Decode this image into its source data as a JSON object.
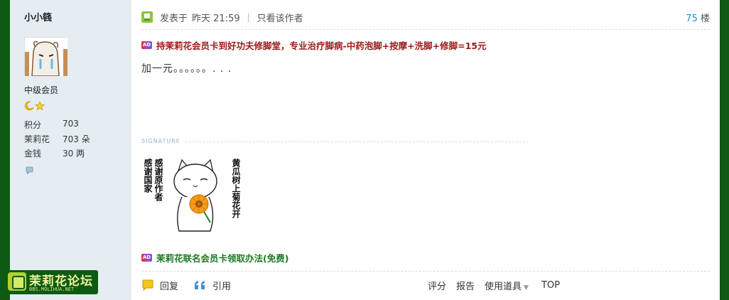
{
  "user": {
    "name": "小小篯",
    "rank": "中级会员",
    "stats": [
      {
        "label": "积分",
        "value": "703"
      },
      {
        "label": "茉莉花",
        "value": "703 朵"
      },
      {
        "label": "金钱",
        "value": "30 两"
      }
    ]
  },
  "post": {
    "posted_label": "发表于",
    "posted_time": "昨天 21:59",
    "separator": "|",
    "author_only": "只看该作者",
    "floor_number": "75",
    "floor_suffix": "楼",
    "ad_badge": "AD",
    "ad_top": "持茉莉花会员卡到好功夫修脚堂，专业治疗脚病-中药泡脚+按摩+洗脚+修脚=15元",
    "message": "加一元。。。。。。. . .",
    "signature_label": "SIGNATURE",
    "sig_text_left_1": "感谢国家",
    "sig_text_left_2": "感谢原作者",
    "sig_text_right": "黄瓜树上菊花开",
    "ad_bottom": "茉莉花联名会员卡领取办法(免费)"
  },
  "footer": {
    "reply": "回复",
    "quote": "引用",
    "rate": "评分",
    "report": "报告",
    "tools": "使用道具",
    "top": "TOP"
  },
  "logo": {
    "name": "茉莉花论坛",
    "url": "BBS.MOLIHUA.NET"
  },
  "colors": {
    "outer_bg": "#0e5a14",
    "sidebar_bg": "#e5edf2",
    "ad_red": "#9b1a1a",
    "ad_green": "#1d7a23",
    "floor_blue": "#2a8bc9"
  }
}
